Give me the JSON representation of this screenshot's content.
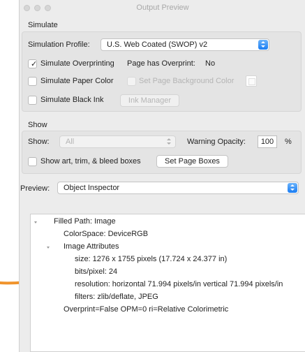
{
  "window": {
    "title": "Output Preview"
  },
  "simulate": {
    "section": "Simulate",
    "profile_label": "Simulation Profile:",
    "profile_value": "U.S. Web Coated (SWOP) v2",
    "overprint_label": "Simulate Overprinting",
    "overprint_checked": true,
    "page_has_overprint_label": "Page has Overprint:",
    "page_has_overprint_value": "No",
    "paper_color_label": "Simulate Paper Color",
    "set_bg_label": "Set Page Background Color",
    "black_ink_label": "Simulate Black Ink",
    "ink_manager_label": "Ink Manager"
  },
  "show": {
    "section": "Show",
    "show_label": "Show:",
    "show_value": "All",
    "warning_opacity_label": "Warning Opacity:",
    "warning_opacity_value": "100",
    "percent": "%",
    "boxes_label": "Show art, trim, & bleed boxes",
    "set_page_boxes_label": "Set Page Boxes"
  },
  "preview": {
    "label": "Preview:",
    "value": "Object Inspector"
  },
  "inspector": {
    "filled_path": "Filled Path: Image",
    "colorspace": "ColorSpace: DeviceRGB",
    "image_attributes": "Image Attributes",
    "size": "size: 1276 x 1755 pixels (17.724 x 24.377 in)",
    "bits": "bits/pixel: 24",
    "resolution": "resolution: horizontal 71.994 pixels/in vertical 71.994 pixels/in",
    "filters": "filters: zlib/deflate, JPEG",
    "overprint": "Overprint=False OPM=0 ri=Relative Colorimetric"
  },
  "colors": {
    "accent": "#1a7df3",
    "annotation_arrow": "#f0932b"
  }
}
